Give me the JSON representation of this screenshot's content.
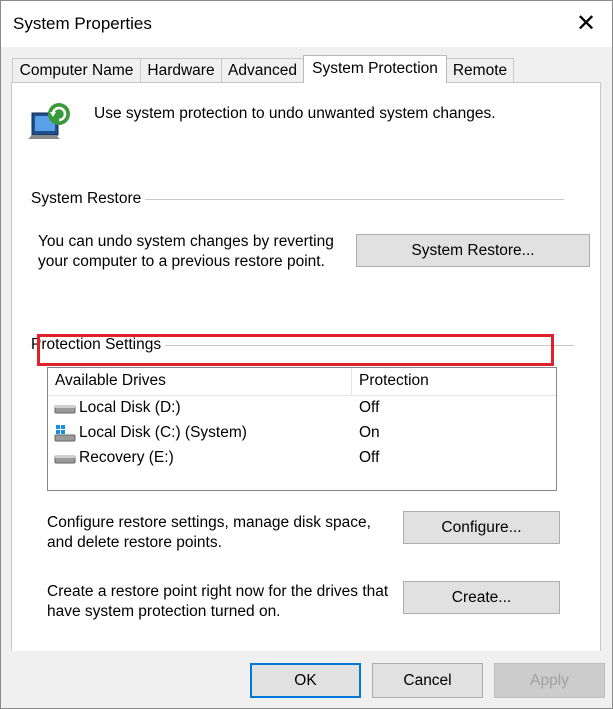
{
  "window": {
    "title": "System Properties",
    "close_glyph": "✕"
  },
  "tabs": [
    {
      "label": "Computer Name"
    },
    {
      "label": "Hardware"
    },
    {
      "label": "Advanced"
    },
    {
      "label": "System Protection"
    },
    {
      "label": "Remote"
    }
  ],
  "header_text": "Use system protection to undo unwanted system changes.",
  "system_restore": {
    "title": "System Restore",
    "desc_line1": "You can undo system changes by reverting",
    "desc_line2": "your computer to a previous restore point.",
    "button": "System Restore..."
  },
  "protection": {
    "title": "Protection Settings",
    "columns": [
      "Available Drives",
      "Protection"
    ],
    "drives": [
      {
        "name": "Local Disk (D:)",
        "protection": "Off",
        "icon": "drive-icon"
      },
      {
        "name": "Local Disk (C:) (System)",
        "protection": "On",
        "icon": "windows-drive-icon"
      },
      {
        "name": "Recovery (E:)",
        "protection": "Off",
        "icon": "drive-icon"
      }
    ],
    "configure_line1": "Configure restore settings, manage disk space,",
    "configure_line2": "and delete restore points.",
    "configure_button": "Configure...",
    "create_line1": "Create a restore point right now for the drives that",
    "create_line2": "have system protection turned on.",
    "create_button": "Create..."
  },
  "footer": {
    "ok": "OK",
    "cancel": "Cancel",
    "apply": "Apply"
  },
  "colors": {
    "highlight": "#e0202a",
    "accent": "#0078d7"
  }
}
